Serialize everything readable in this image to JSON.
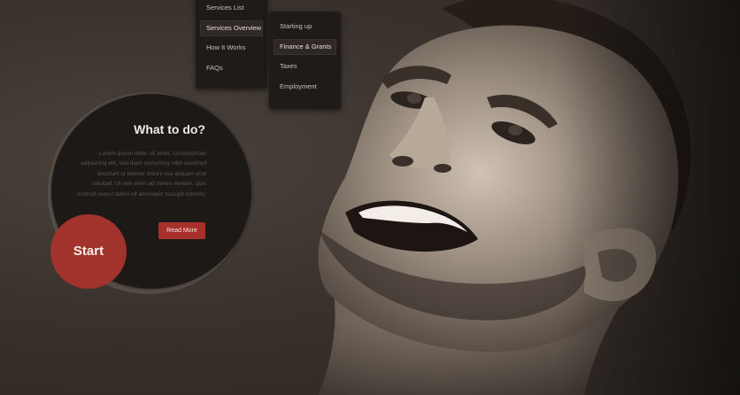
{
  "menu_primary": {
    "items": [
      {
        "label": "Services List"
      },
      {
        "label": "Services Overview"
      },
      {
        "label": "How It Works"
      },
      {
        "label": "FAQs"
      }
    ]
  },
  "menu_secondary": {
    "items": [
      {
        "label": "Starting up"
      },
      {
        "label": "Finance & Grants"
      },
      {
        "label": "Taxes"
      },
      {
        "label": "Employment"
      }
    ]
  },
  "promo": {
    "title": "What to do?",
    "body": "Lorem ipsum dolor sit amet, consectetuer adipiscing elit, sed diam nonummy nibh euismod tincidunt ut laoreet dolore ma aliquam erat volutpat. Ut wisi enim ad minim veniam, quis nostrud exerci tation ull amcorper suscipit lobortis.",
    "read_more_label": "Read More",
    "start_label": "Start"
  },
  "colors": {
    "accent": "#a2332c",
    "menu_bg": "#1f1b19",
    "background": "#3a332e"
  }
}
